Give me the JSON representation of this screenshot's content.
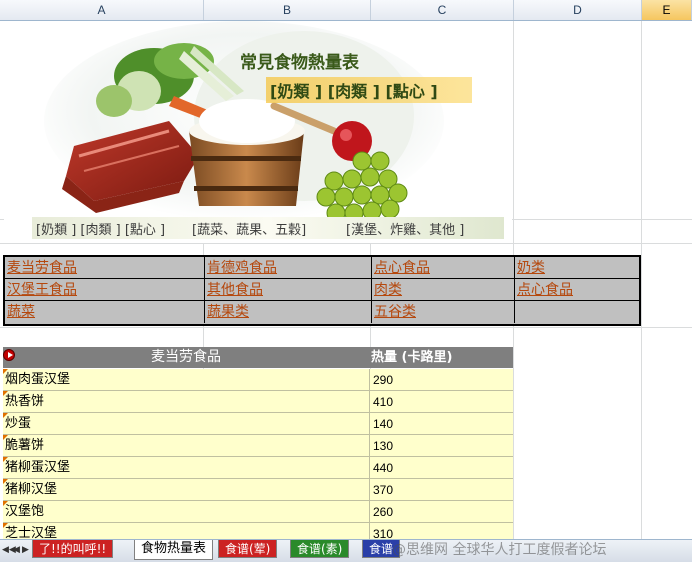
{
  "columns": [
    "A",
    "B",
    "C",
    "D",
    "E"
  ],
  "banner": {
    "title": "常見食物熱量表",
    "subtitle": "[奶類 ] [肉類 ] [點心 ]",
    "categories": [
      "[奶類 ] [肉類 ] [點心 ]",
      "[蔬菜、蔬果、五穀]",
      "[漢堡、炸雞、其他 ]"
    ]
  },
  "links": [
    [
      "麦当劳食品",
      "肯德鸡食品",
      "点心食品",
      "奶类"
    ],
    [
      "汉堡王食品",
      "其他食品",
      "肉类",
      "点心食品"
    ],
    [
      "蔬菜",
      "蔬果类",
      "五谷类",
      ""
    ]
  ],
  "table": {
    "header_name": "麦当劳食品",
    "header_value": "热量 (卡路里)",
    "rows": [
      {
        "name": "烟肉蛋汉堡",
        "value": "290"
      },
      {
        "name": "热香饼",
        "value": "410"
      },
      {
        "name": "炒蛋",
        "value": "140"
      },
      {
        "name": "脆薯饼",
        "value": "130"
      },
      {
        "name": "猪柳蛋汉堡",
        "value": "440"
      },
      {
        "name": "猪柳汉堡",
        "value": "370"
      },
      {
        "name": "汉堡饱",
        "value": "260"
      },
      {
        "name": "芝士汉堡",
        "value": "310"
      }
    ]
  },
  "tabs": [
    "了!!的叫呼!!",
    "食物热量表",
    "食谱(荤)",
    "食谱(素)",
    "食谱"
  ],
  "active_tab": "食物热量表",
  "watermark": "@思维网 全球华人打工度假者论坛",
  "colors": {
    "link": "#b5480d",
    "header_bg": "#7f7f7f",
    "row_bg": "#ffffcc",
    "link_table_bg": "#c0c0c0",
    "tab_red": "#cc2222",
    "tab_green": "#2a8a2a",
    "tab_blue": "#2a3fa8"
  }
}
